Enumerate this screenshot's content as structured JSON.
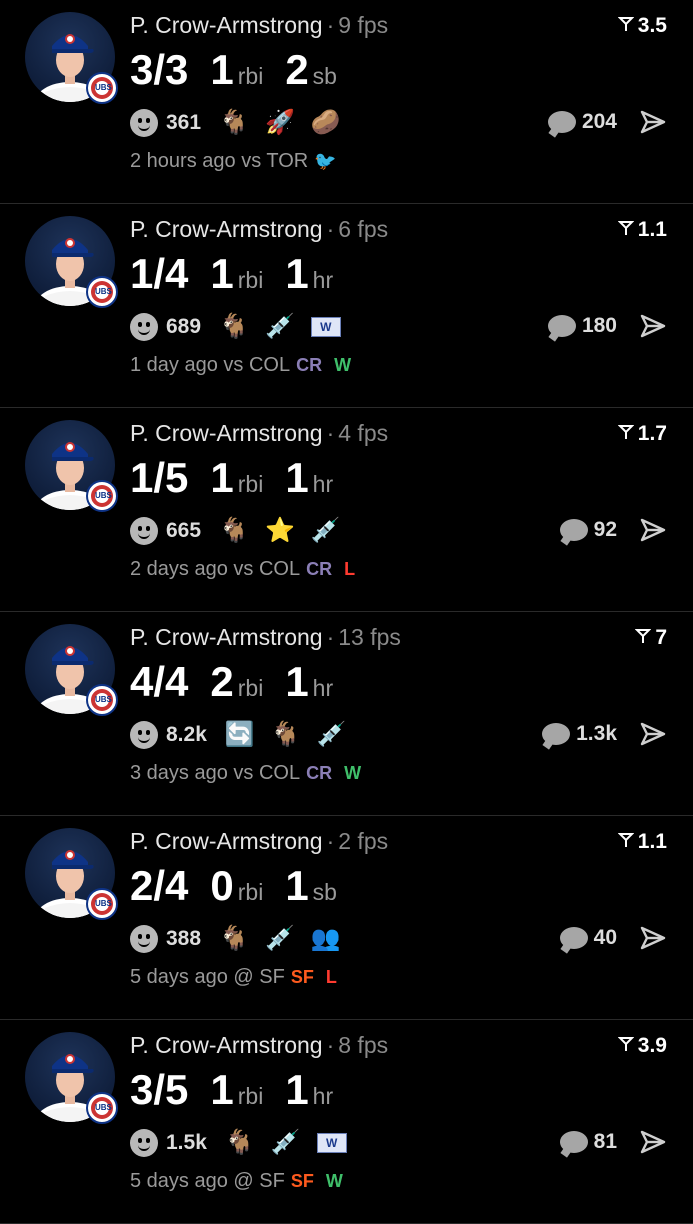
{
  "cards": [
    {
      "player": "P. Crow-Armstrong",
      "fps": "9 fps",
      "score": "3.5",
      "stats": [
        {
          "v": "3/3",
          "u": ""
        },
        {
          "v": "1",
          "u": "rbi"
        },
        {
          "v": "2",
          "u": "sb"
        }
      ],
      "reaction_count": "361",
      "reactions": [
        "goat",
        "rocket",
        "potato"
      ],
      "comments": "204",
      "time": "2 hours ago vs TOR",
      "opponent_logo": "blue-jays-logo",
      "result": ""
    },
    {
      "player": "P. Crow-Armstrong",
      "fps": "6 fps",
      "score": "1.1",
      "stats": [
        {
          "v": "1/4",
          "u": ""
        },
        {
          "v": "1",
          "u": "rbi"
        },
        {
          "v": "1",
          "u": "hr"
        }
      ],
      "reaction_count": "689",
      "reactions": [
        "goat",
        "syringe",
        "w-flag"
      ],
      "comments": "180",
      "time": "1 day ago vs COL",
      "opponent_logo": "rockies-logo",
      "result": "W"
    },
    {
      "player": "P. Crow-Armstrong",
      "fps": "4 fps",
      "score": "1.7",
      "stats": [
        {
          "v": "1/5",
          "u": ""
        },
        {
          "v": "1",
          "u": "rbi"
        },
        {
          "v": "1",
          "u": "hr"
        }
      ],
      "reaction_count": "665",
      "reactions": [
        "goat",
        "star",
        "syringe"
      ],
      "comments": "92",
      "time": "2 days ago vs COL",
      "opponent_logo": "rockies-logo",
      "result": "L"
    },
    {
      "player": "P. Crow-Armstrong",
      "fps": "13 fps",
      "score": "7",
      "stats": [
        {
          "v": "4/4",
          "u": ""
        },
        {
          "v": "2",
          "u": "rbi"
        },
        {
          "v": "1",
          "u": "hr"
        }
      ],
      "reaction_count": "8.2k",
      "reactions": [
        "repeat",
        "goat",
        "syringe"
      ],
      "comments": "1.3k",
      "time": "3 days ago vs COL",
      "opponent_logo": "rockies-logo",
      "result": "W"
    },
    {
      "player": "P. Crow-Armstrong",
      "fps": "2 fps",
      "score": "1.1",
      "stats": [
        {
          "v": "2/4",
          "u": ""
        },
        {
          "v": "0",
          "u": "rbi"
        },
        {
          "v": "1",
          "u": "sb"
        }
      ],
      "reaction_count": "388",
      "reactions": [
        "goat",
        "syringe",
        "players-photo"
      ],
      "comments": "40",
      "time": "5 days ago @ SF",
      "opponent_logo": "giants-logo",
      "result": "L"
    },
    {
      "player": "P. Crow-Armstrong",
      "fps": "8 fps",
      "score": "3.9",
      "stats": [
        {
          "v": "3/5",
          "u": ""
        },
        {
          "v": "1",
          "u": "rbi"
        },
        {
          "v": "1",
          "u": "hr"
        }
      ],
      "reaction_count": "1.5k",
      "reactions": [
        "goat",
        "syringe",
        "w-flag"
      ],
      "comments": "81",
      "time": "5 days ago @ SF",
      "opponent_logo": "giants-logo",
      "result": "W"
    }
  ]
}
